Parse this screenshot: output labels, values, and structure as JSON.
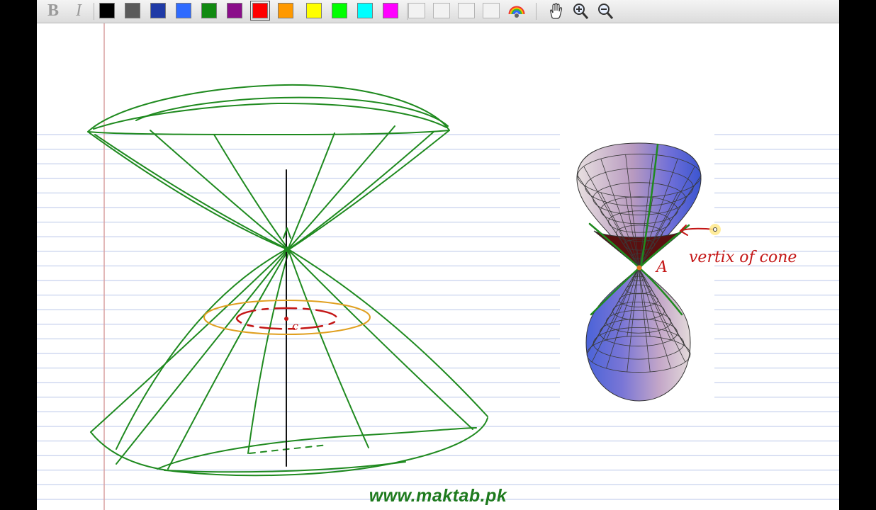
{
  "toolbar": {
    "bold_label": "B",
    "italic_label": "I",
    "colors": [
      {
        "name": "black",
        "hex": "#000000"
      },
      {
        "name": "gray",
        "hex": "#5a5a5a"
      },
      {
        "name": "navy",
        "hex": "#1f3aa6"
      },
      {
        "name": "blue",
        "hex": "#2f6bff"
      },
      {
        "name": "green",
        "hex": "#118a11"
      },
      {
        "name": "purple",
        "hex": "#8a0d8a"
      },
      {
        "name": "red",
        "hex": "#ff0000"
      },
      {
        "name": "orange",
        "hex": "#ff9900"
      },
      {
        "name": "yellow",
        "hex": "#ffff00"
      },
      {
        "name": "lime",
        "hex": "#00ff00"
      },
      {
        "name": "cyan",
        "hex": "#00ffff"
      },
      {
        "name": "magenta",
        "hex": "#ff00ff"
      }
    ],
    "selected_color": "red",
    "tools": [
      "color-palette-icon",
      "hand-tool-icon",
      "zoom-in-icon",
      "zoom-out-icon"
    ]
  },
  "drawing": {
    "vertex_label": "A",
    "center_label": "c",
    "annotation": "vertix of cone",
    "ink_green": "#1f8a1f",
    "ink_red": "#c41616",
    "ink_orange": "#e0a020"
  },
  "watermark": "www.maktab.pk"
}
